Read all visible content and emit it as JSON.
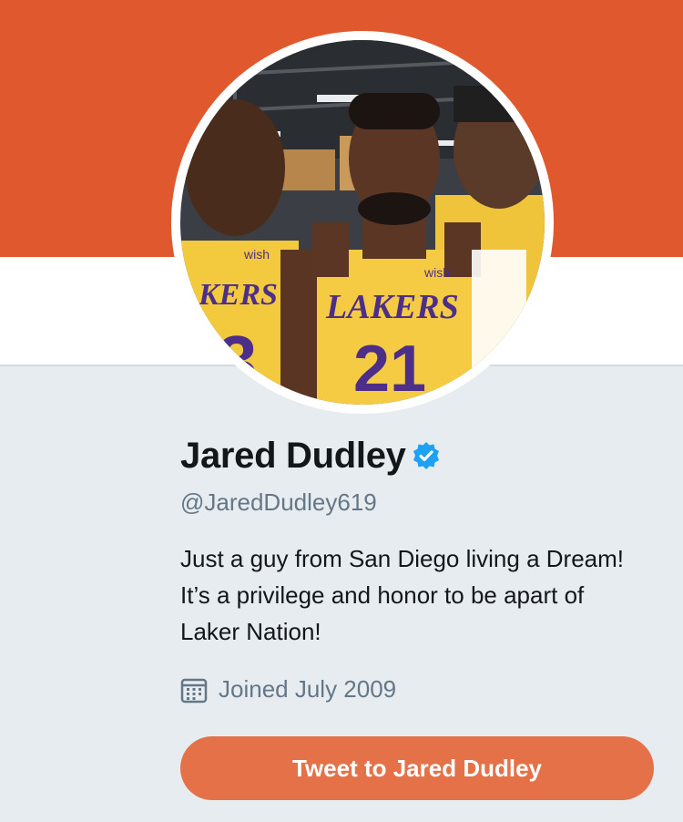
{
  "colors": {
    "banner": "#e0592e",
    "accent": "#e57148",
    "background": "#e6ecf0",
    "verified": "#1da1f2",
    "muted_text": "#657786"
  },
  "profile": {
    "name": "Jared Dudley",
    "verified_icon": "verified-badge-icon",
    "handle": "@JaredDudley619",
    "bio": "Just a guy from San Diego living a Dream! It’s a privilege and honor to be apart of Laker Nation!",
    "joined_icon": "calendar-icon",
    "joined": "Joined July 2009"
  },
  "avatar": {
    "jersey_team": "LAKERS",
    "jersey_number": "21",
    "left_jersey_partial": "KERS",
    "left_number_partial": "3",
    "sponsor": "wish"
  },
  "actions": {
    "tweet_to": "Tweet to Jared Dudley"
  }
}
